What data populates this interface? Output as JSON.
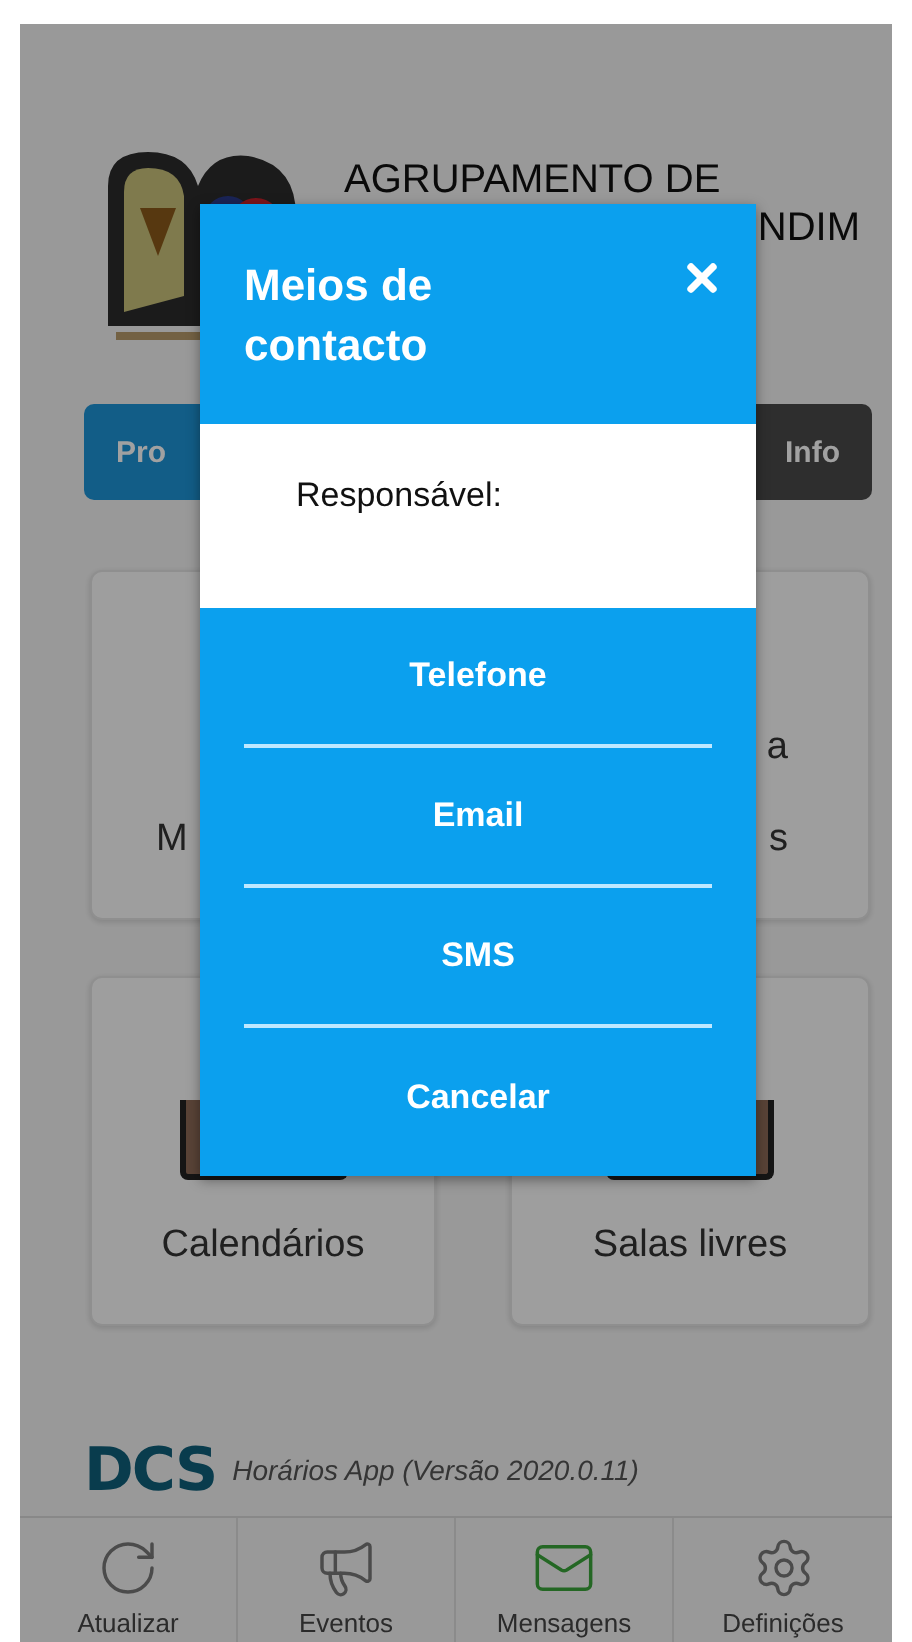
{
  "header": {
    "title_lines": [
      "AGRUPAMENTO DE",
      "NDIM"
    ]
  },
  "action_buttons": [
    {
      "label": "Pro",
      "kind": "primary"
    },
    {
      "label": "Info",
      "kind": "dark"
    }
  ],
  "cards": [
    {
      "label_lines": [
        "M"
      ]
    },
    {
      "label_lines": [
        "a",
        "s"
      ]
    },
    {
      "label_lines": [
        "Calendários"
      ]
    },
    {
      "label_lines": [
        "Salas livres"
      ]
    }
  ],
  "footer": {
    "brand": "DCS",
    "text": "Horários App (Versão 2020.0.11)"
  },
  "tabs": [
    {
      "label": "Atualizar",
      "kind": "refresh",
      "selected": false
    },
    {
      "label": "Eventos",
      "kind": "megaphone",
      "selected": false
    },
    {
      "label": "Mensagens",
      "kind": "mail",
      "selected": true
    },
    {
      "label": "Definições",
      "kind": "settings",
      "selected": false
    }
  ],
  "dialog": {
    "title": "Meios de contacto",
    "body_label": "Responsável:",
    "options": [
      "Telefone",
      "Email",
      "SMS",
      "Cancelar"
    ]
  }
}
